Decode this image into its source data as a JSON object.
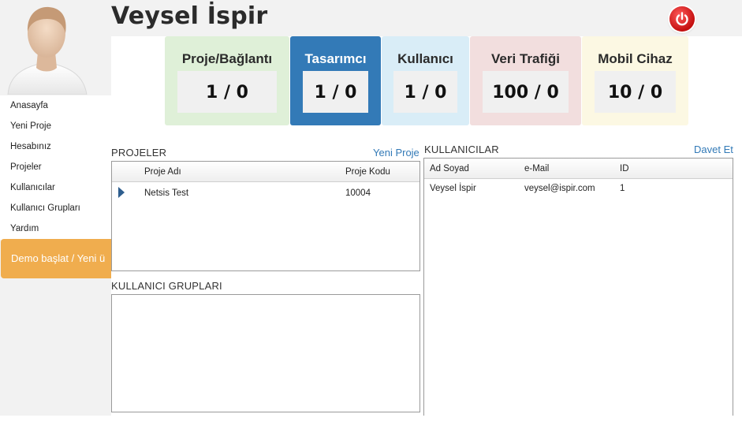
{
  "header": {
    "user_name": "Veysel İspir"
  },
  "sidebar": {
    "menu": [
      "Anasayfa",
      "Yeni Proje",
      "Hesabınız",
      "Projeler",
      "Kullanıcılar",
      "Kullanıcı Grupları",
      "Yardım"
    ],
    "demo_button": "Demo başlat / Yeni ü"
  },
  "stats": [
    {
      "label": "Proje/Bağlantı",
      "value": "1 / 0"
    },
    {
      "label": "Tasarımcı",
      "value": "1 / 0"
    },
    {
      "label": "Kullanıcı",
      "value": "1 / 0"
    },
    {
      "label": "Veri Trafiği",
      "value": "100 / 0"
    },
    {
      "label": "Mobil Cihaz",
      "value": "10 / 0"
    }
  ],
  "colors": {
    "card_proje": "#dff0d8",
    "card_tasarimci": "#337ab7",
    "card_kullanici": "#d9edf7",
    "card_veri": "#f2dede",
    "card_mobil": "#fcf8e3",
    "link": "#337ab7",
    "demo": "#f0ad4e"
  },
  "projects": {
    "title": "PROJELER",
    "add_link": "Yeni Proje",
    "columns": [
      "Proje Adı",
      "Proje Kodu"
    ],
    "rows": [
      {
        "name": "Netsis Test",
        "code": "10004"
      }
    ]
  },
  "groups": {
    "title": "KULLANICI GRUPLARI"
  },
  "users": {
    "title": "KULLANICILAR",
    "invite_link": "Davet Et",
    "columns": [
      "Ad Soyad",
      "e-Mail",
      "ID"
    ],
    "rows": [
      {
        "name": "Veysel İspir",
        "email": "veysel@ispir.com",
        "id": "1"
      }
    ]
  },
  "icons": {
    "power": "power-icon",
    "avatar": "user-avatar-icon",
    "row_marker": "row-selector-icon"
  }
}
